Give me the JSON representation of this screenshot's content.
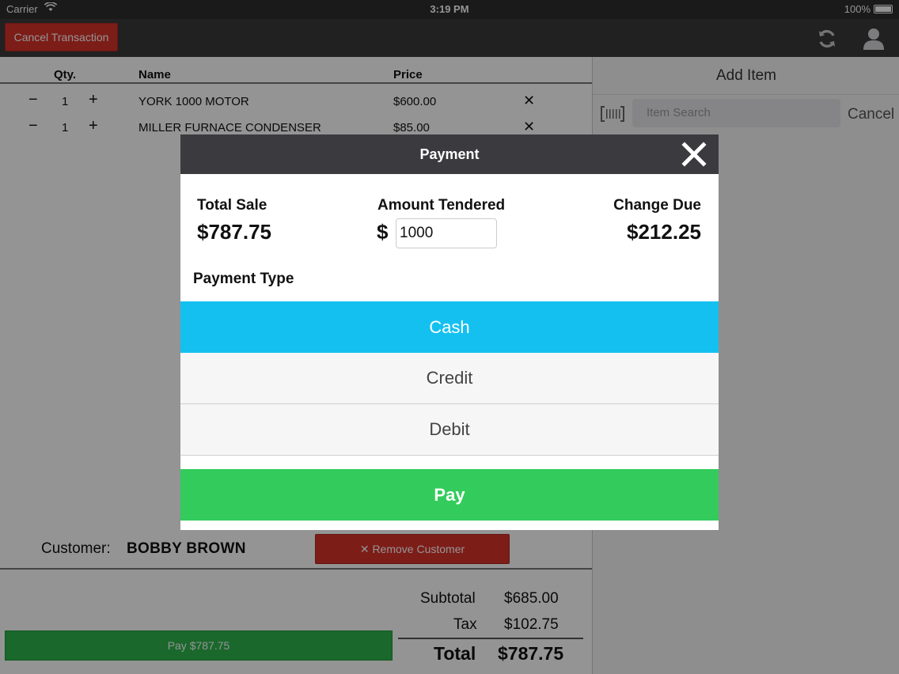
{
  "status_bar": {
    "carrier": "Carrier",
    "time": "3:19 PM",
    "battery": "100%"
  },
  "toolbar": {
    "cancel_label": "Cancel Transaction",
    "refresh_icon": "refresh-icon",
    "user_icon": "user-icon"
  },
  "cart": {
    "headers": {
      "qty": "Qty.",
      "name": "Name",
      "price": "Price"
    },
    "rows": [
      {
        "minus": "−",
        "qty": "1",
        "plus": "+",
        "name": "YORK 1000 MOTOR",
        "price": "$600.00",
        "remove": "✕"
      },
      {
        "minus": "−",
        "qty": "1",
        "plus": "+",
        "name": "MILLER FURNACE CONDENSER",
        "price": "$85.00",
        "remove": "✕"
      }
    ]
  },
  "add_item": {
    "title": "Add Item",
    "search_placeholder": "Item Search",
    "cancel_label": "Cancel"
  },
  "customer": {
    "label": "Customer:",
    "name": "BOBBY BROWN",
    "remove_label": "✕ Remove Customer"
  },
  "totals": {
    "subtotal_label": "Subtotal",
    "subtotal": "$685.00",
    "tax_label": "Tax",
    "tax": "$102.75",
    "total_label": "Total",
    "total": "$787.75",
    "pay_label": "Pay $787.75"
  },
  "modal": {
    "title": "Payment",
    "total_sale_label": "Total Sale",
    "total_sale": "$787.75",
    "amount_tendered_label": "Amount Tendered",
    "currency": "$",
    "amount_tendered": "1000",
    "change_due_label": "Change Due",
    "change_due": "$212.25",
    "payment_type_label": "Payment Type",
    "payment_types": [
      "Cash",
      "Credit",
      "Debit"
    ],
    "selected_payment": "Cash",
    "pay_label": "Pay"
  },
  "colors": {
    "accent_selected": "#14c0f0",
    "pay_green": "#33cc5c",
    "danger": "#d7322a",
    "header_dark": "#3b3a3e"
  }
}
